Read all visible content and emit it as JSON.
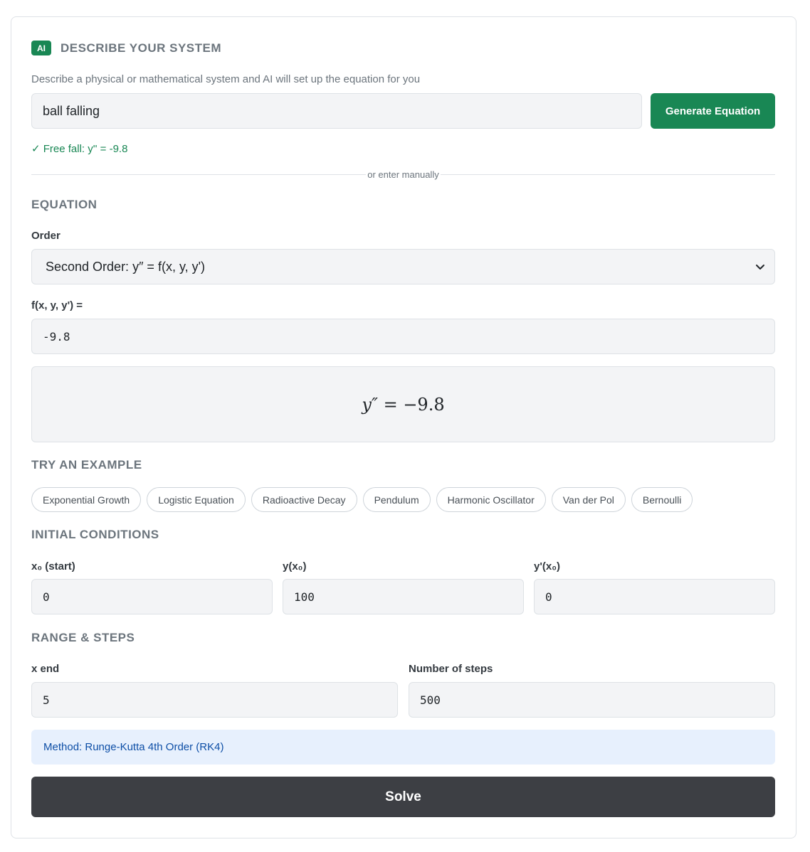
{
  "ai": {
    "badge": "AI",
    "title": "DESCRIBE YOUR SYSTEM",
    "description": "Describe a physical or mathematical system and AI will set up the equation for you",
    "input_value": "ball falling",
    "generate_label": "Generate Equation",
    "result": "✓ Free fall: y'' = -9.8"
  },
  "divider_text": "or enter manually",
  "equation": {
    "title": "EQUATION",
    "order_label": "Order",
    "order_value": "Second Order: y″ = f(x, y, y')",
    "f_label": "f(x, y, y') =",
    "f_value": "-9.8",
    "preview_lhs": "y″",
    "preview_eq": " = ",
    "preview_rhs": "−9.8"
  },
  "examples": {
    "title": "TRY AN EXAMPLE",
    "items": [
      "Exponential Growth",
      "Logistic Equation",
      "Radioactive Decay",
      "Pendulum",
      "Harmonic Oscillator",
      "Van der Pol",
      "Bernoulli"
    ]
  },
  "initial_conditions": {
    "title": "INITIAL CONDITIONS",
    "x0_label": "x₀ (start)",
    "x0_value": "0",
    "y0_label": "y(x₀)",
    "y0_value": "100",
    "yp0_label": "y'(x₀)",
    "yp0_value": "0"
  },
  "range": {
    "title": "RANGE & STEPS",
    "xend_label": "x end",
    "xend_value": "5",
    "steps_label": "Number of steps",
    "steps_value": "500"
  },
  "method": "Method: Runge-Kutta 4th Order (RK4)",
  "solve_label": "Solve",
  "colors": {
    "accent_green": "#198754",
    "method_bg": "#e7f0fd",
    "method_text": "#0d4ea6",
    "solve_bg": "#3d3f44"
  }
}
